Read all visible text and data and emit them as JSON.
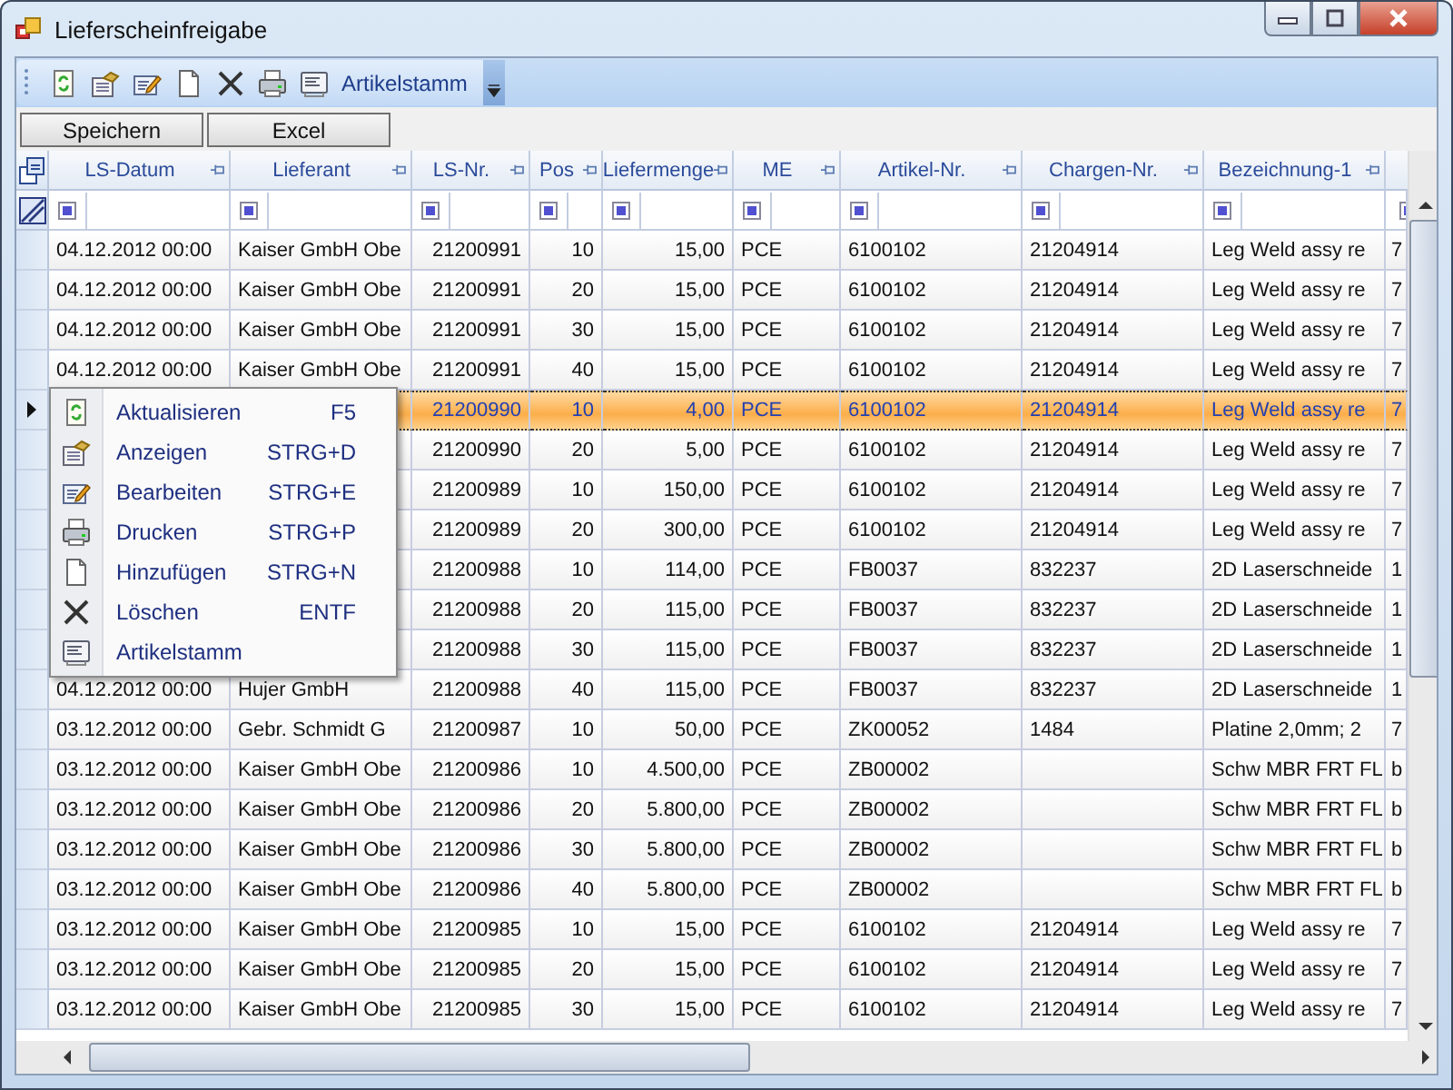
{
  "window": {
    "title": "Lieferscheinfreigabe"
  },
  "toolbar": {
    "label": "Artikelstamm"
  },
  "buttons": [
    "Speichern",
    "Excel"
  ],
  "grid": {
    "columns": [
      "LS-Datum",
      "Lieferant",
      "LS-Nr.",
      "Pos",
      "Liefermenge",
      "ME",
      "Artikel-Nr.",
      "Chargen-Nr.",
      "Bezeichnung-1"
    ],
    "rows": [
      {
        "selected": false,
        "cells": [
          "04.12.2012 00:00",
          "Kaiser GmbH Obe",
          "21200991",
          "10",
          "15,00",
          "PCE",
          "6100102",
          "21204914",
          "Leg Weld assy re",
          "7"
        ]
      },
      {
        "selected": false,
        "cells": [
          "04.12.2012 00:00",
          "Kaiser GmbH Obe",
          "21200991",
          "20",
          "15,00",
          "PCE",
          "6100102",
          "21204914",
          "Leg Weld assy re",
          "7"
        ]
      },
      {
        "selected": false,
        "cells": [
          "04.12.2012 00:00",
          "Kaiser GmbH Obe",
          "21200991",
          "30",
          "15,00",
          "PCE",
          "6100102",
          "21204914",
          "Leg Weld assy re",
          "7"
        ]
      },
      {
        "selected": false,
        "cells": [
          "04.12.2012 00:00",
          "Kaiser GmbH Obe",
          "21200991",
          "40",
          "15,00",
          "PCE",
          "6100102",
          "21204914",
          "Leg Weld assy re",
          "7"
        ]
      },
      {
        "selected": true,
        "cells": [
          null,
          null,
          "21200990",
          "10",
          "4,00",
          "PCE",
          "6100102",
          "21204914",
          "Leg Weld assy re",
          "7"
        ]
      },
      {
        "selected": false,
        "cells": [
          null,
          null,
          "21200990",
          "20",
          "5,00",
          "PCE",
          "6100102",
          "21204914",
          "Leg Weld assy re",
          "7"
        ]
      },
      {
        "selected": false,
        "cells": [
          null,
          null,
          "21200989",
          "10",
          "150,00",
          "PCE",
          "6100102",
          "21204914",
          "Leg Weld assy re",
          "7"
        ]
      },
      {
        "selected": false,
        "cells": [
          null,
          null,
          "21200989",
          "20",
          "300,00",
          "PCE",
          "6100102",
          "21204914",
          "Leg Weld assy re",
          "7"
        ]
      },
      {
        "selected": false,
        "cells": [
          null,
          null,
          "21200988",
          "10",
          "114,00",
          "PCE",
          "FB0037",
          "832237",
          "2D Laserschneide",
          "1"
        ]
      },
      {
        "selected": false,
        "cells": [
          null,
          null,
          "21200988",
          "20",
          "115,00",
          "PCE",
          "FB0037",
          "832237",
          "2D Laserschneide",
          "1"
        ]
      },
      {
        "selected": false,
        "cells": [
          null,
          null,
          "21200988",
          "30",
          "115,00",
          "PCE",
          "FB0037",
          "832237",
          "2D Laserschneide",
          "1"
        ]
      },
      {
        "selected": false,
        "cells": [
          "04.12.2012 00:00",
          "Hujer GmbH",
          "21200988",
          "40",
          "115,00",
          "PCE",
          "FB0037",
          "832237",
          "2D Laserschneide",
          "1"
        ]
      },
      {
        "selected": false,
        "cells": [
          "03.12.2012 00:00",
          "Gebr. Schmidt G",
          "21200987",
          "10",
          "50,00",
          "PCE",
          "ZK00052",
          "1484",
          "Platine 2,0mm; 2",
          "7"
        ]
      },
      {
        "selected": false,
        "cells": [
          "03.12.2012 00:00",
          "Kaiser GmbH Obe",
          "21200986",
          "10",
          "4.500,00",
          "PCE",
          "ZB00002",
          null,
          "Schw MBR FRT FL",
          "b"
        ]
      },
      {
        "selected": false,
        "cells": [
          "03.12.2012 00:00",
          "Kaiser GmbH Obe",
          "21200986",
          "20",
          "5.800,00",
          "PCE",
          "ZB00002",
          null,
          "Schw MBR FRT FL",
          "b"
        ]
      },
      {
        "selected": false,
        "cells": [
          "03.12.2012 00:00",
          "Kaiser GmbH Obe",
          "21200986",
          "30",
          "5.800,00",
          "PCE",
          "ZB00002",
          null,
          "Schw MBR FRT FL",
          "b"
        ]
      },
      {
        "selected": false,
        "cells": [
          "03.12.2012 00:00",
          "Kaiser GmbH Obe",
          "21200986",
          "40",
          "5.800,00",
          "PCE",
          "ZB00002",
          null,
          "Schw MBR FRT FL",
          "b"
        ]
      },
      {
        "selected": false,
        "cells": [
          "03.12.2012 00:00",
          "Kaiser GmbH Obe",
          "21200985",
          "10",
          "15,00",
          "PCE",
          "6100102",
          "21204914",
          "Leg Weld assy re",
          "7"
        ]
      },
      {
        "selected": false,
        "cells": [
          "03.12.2012 00:00",
          "Kaiser GmbH Obe",
          "21200985",
          "20",
          "15,00",
          "PCE",
          "6100102",
          "21204914",
          "Leg Weld assy re",
          "7"
        ]
      },
      {
        "selected": false,
        "cells": [
          "03.12.2012 00:00",
          "Kaiser GmbH Obe",
          "21200985",
          "30",
          "15,00",
          "PCE",
          "6100102",
          "21204914",
          "Leg Weld assy re",
          "7"
        ]
      }
    ]
  },
  "context_menu": {
    "items": [
      {
        "label": "Aktualisieren",
        "shortcut": "F5"
      },
      {
        "label": "Anzeigen",
        "shortcut": "STRG+D"
      },
      {
        "label": "Bearbeiten",
        "shortcut": "STRG+E"
      },
      {
        "label": "Drucken",
        "shortcut": "STRG+P"
      },
      {
        "label": "Hinzufügen",
        "shortcut": "STRG+N"
      },
      {
        "label": "Löschen",
        "shortcut": "ENTF"
      },
      {
        "label": "Artikelstamm"
      }
    ]
  }
}
